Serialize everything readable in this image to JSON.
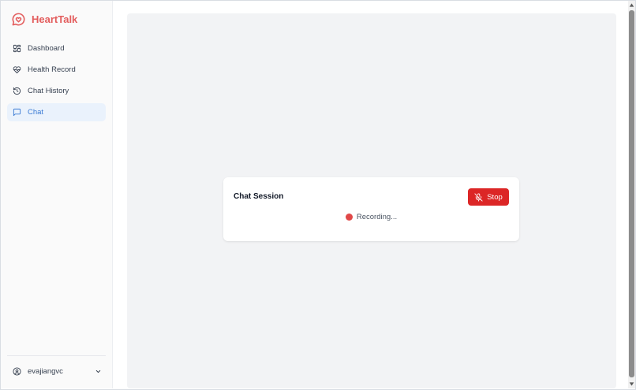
{
  "app": {
    "name": "HeartTalk",
    "brand_color": "#e35d5d"
  },
  "sidebar": {
    "items": [
      {
        "label": "Dashboard",
        "icon": "dashboard-icon",
        "active": false
      },
      {
        "label": "Health Record",
        "icon": "heart-pulse-icon",
        "active": false
      },
      {
        "label": "Chat History",
        "icon": "history-icon",
        "active": false
      },
      {
        "label": "Chat",
        "icon": "chat-bubble-icon",
        "active": true
      }
    ],
    "active_color": "#3b7bd4"
  },
  "user": {
    "name": "evajiangvc",
    "icon": "user-circle-icon"
  },
  "session": {
    "title": "Chat Session",
    "stop_label": "Stop",
    "stop_icon": "mic-off-icon",
    "stop_color": "#dc2626",
    "status_text": "Recording...",
    "status_color": "#e04848"
  }
}
